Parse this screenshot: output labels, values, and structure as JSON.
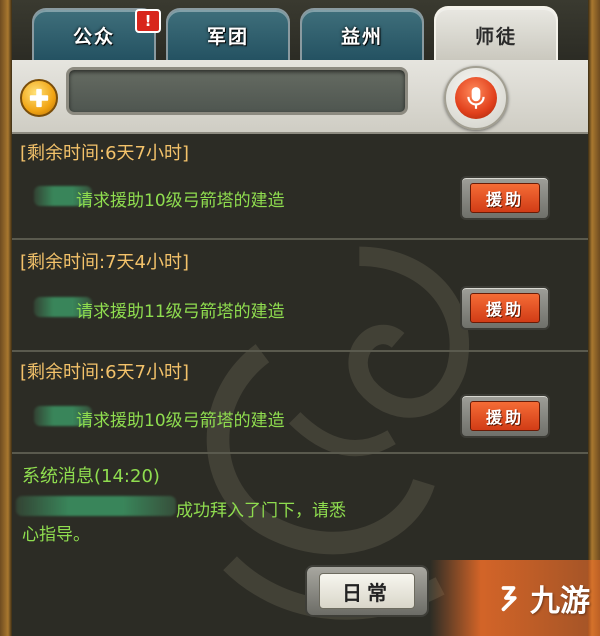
{
  "tabs": [
    {
      "label": "公众",
      "active": false
    },
    {
      "label": "军团",
      "active": false
    },
    {
      "label": "益州",
      "active": false
    },
    {
      "label": "师徒",
      "active": true
    }
  ],
  "alert_badge": "!",
  "chat_input": {
    "value": "",
    "placeholder": ""
  },
  "messages": [
    {
      "remaining": "[剩余时间:6天7小时]",
      "request": "请求援助10级弓箭塔的建造",
      "button": "援助"
    },
    {
      "remaining": "[剩余时间:7天4小时]",
      "request": "请求援助11级弓箭塔的建造",
      "button": "援助"
    },
    {
      "remaining": "[剩余时间:6天7小时]",
      "request": "请求援助10级弓箭塔的建造",
      "button": "援助"
    }
  ],
  "system": {
    "title": "系统消息(14:20)",
    "line1": "成功拜入了门下，请悉",
    "line2": "心指导。"
  },
  "daily_button": "日常",
  "watermark": "九游",
  "colors": {
    "accent_gold": "#f3c26a",
    "text_green": "#8fdd4f",
    "button_orange": "#e0481e",
    "tab_teal": "#2f6070"
  }
}
